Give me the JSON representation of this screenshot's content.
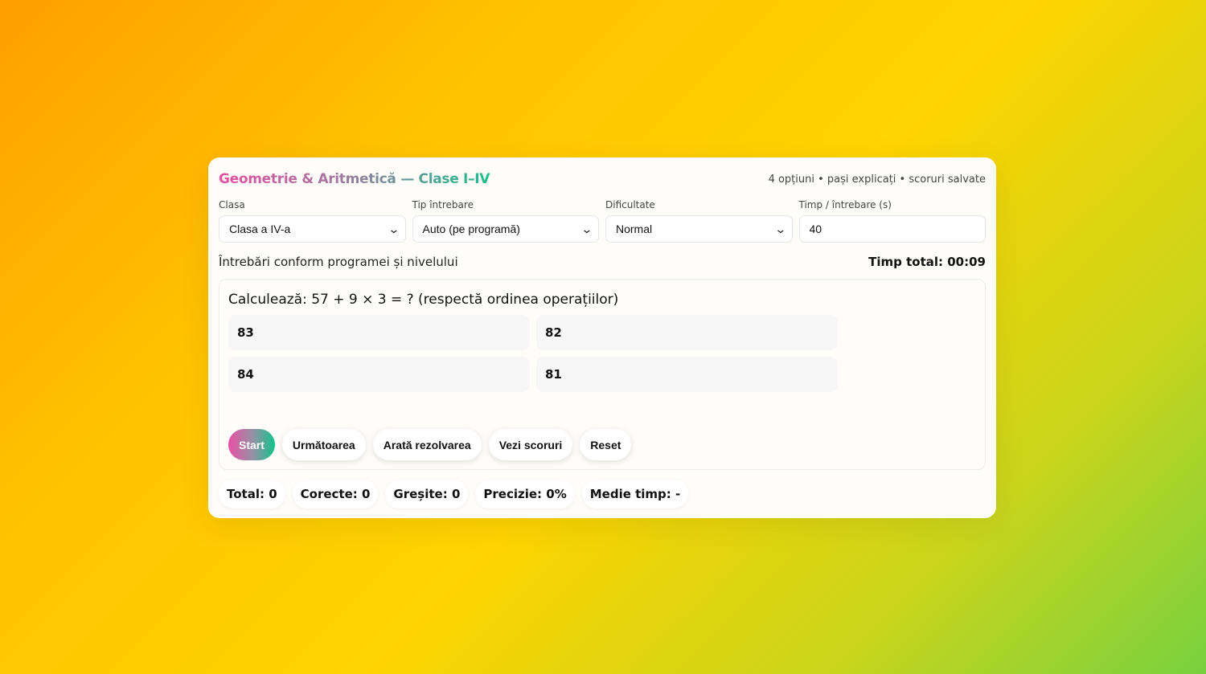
{
  "header": {
    "title": "Geometrie & Aritmetică — Clase I–IV",
    "subtitle": "4 opțiuni • pași explicați • scoruri salvate"
  },
  "controls": {
    "clasa": {
      "label": "Clasa",
      "value": "Clasa a IV-a"
    },
    "tip": {
      "label": "Tip întrebare",
      "value": "Auto (pe programă)"
    },
    "dificultate": {
      "label": "Dificultate",
      "value": "Normal"
    },
    "timp": {
      "label": "Timp / întrebare (s)",
      "value": "40"
    }
  },
  "info": {
    "text": "Întrebări conform programei și nivelului",
    "timer": "Timp total: 00:09"
  },
  "question": {
    "text": "Calculează: 57 + 9 × 3 = ? (respectă ordinea operațiilor)",
    "options": [
      "83",
      "82",
      "84",
      "81"
    ]
  },
  "buttons": {
    "start": "Start",
    "next": "Următoarea",
    "solution": "Arată rezolvarea",
    "scores": "Vezi scoruri",
    "reset": "Reset"
  },
  "stats": {
    "total": "Total: 0",
    "correct": "Corecte: 0",
    "wrong": "Greșite: 0",
    "accuracy": "Precizie: 0%",
    "avg_time": "Medie timp: -"
  },
  "colors": {
    "gradient_pink": "#e64fa0",
    "gradient_green": "#1cbf8c",
    "bg_orange": "#ff9f00",
    "bg_green": "#78d13f"
  }
}
